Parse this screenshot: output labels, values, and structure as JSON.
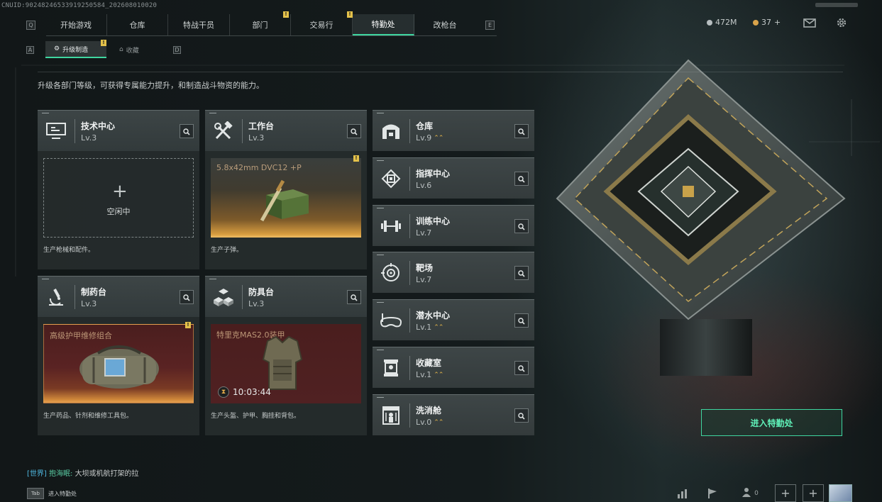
{
  "header": {
    "uid": "CNUID:9024824653391925058​4_202608010020",
    "resources": {
      "currency": "472M",
      "tickets": "37",
      "tickets_add": "+"
    },
    "keyhint_left": "Q",
    "keyhint_right": "E"
  },
  "nav": {
    "tabs": [
      {
        "label": "开始游戏",
        "badge": ""
      },
      {
        "label": "仓库",
        "badge": ""
      },
      {
        "label": "特战干员",
        "badge": ""
      },
      {
        "label": "部门",
        "badge": "!"
      },
      {
        "label": "交易行",
        "badge": ""
      },
      {
        "label": "特勤处",
        "badge": "!",
        "active": true
      },
      {
        "label": "改枪台",
        "badge": ""
      }
    ]
  },
  "subnav": {
    "keyhint_left": "A",
    "keyhint_right": "D",
    "tabs": [
      {
        "label": "升级制造",
        "active": true,
        "badge": "!"
      },
      {
        "label": "收藏",
        "active": false
      }
    ]
  },
  "description": "升级各部门等级，可获得专属能力提升，和制造战斗物资的能力。",
  "departments_large": [
    {
      "name": "技术中心",
      "level": "Lv.3",
      "icon": "monitor-icon",
      "slot_state": "idle",
      "idle_label": "空闲中",
      "footer": "生产枪械和配件。"
    },
    {
      "name": "工作台",
      "level": "Lv.3",
      "icon": "tools-icon",
      "slot_state": "ready",
      "slot_title": "5.8x42mm DVC12 +P",
      "footer": "生产子弹。",
      "badge": "!"
    },
    {
      "name": "制药台",
      "level": "Lv.3",
      "icon": "microscope-icon",
      "slot_state": "ready",
      "slot_title": "高级护甲维修组合",
      "footer": "生产药品、针剂和维修工具包。",
      "badge": "!"
    },
    {
      "name": "防具台",
      "level": "Lv.3",
      "icon": "cubes-icon",
      "slot_state": "crafting",
      "slot_title": "特里克MAS2.0装甲",
      "timer": "10:03:44",
      "footer": "生产头盔、护甲、胸挂和背包。"
    }
  ],
  "departments_small": [
    {
      "name": "仓库",
      "level": "Lv.9",
      "icon": "warehouse-icon",
      "upgradable": true
    },
    {
      "name": "指挥中心",
      "level": "Lv.6",
      "icon": "chip-icon",
      "upgradable": false
    },
    {
      "name": "训练中心",
      "level": "Lv.7",
      "icon": "dumbbell-icon",
      "upgradable": false
    },
    {
      "name": "靶场",
      "level": "Lv.7",
      "icon": "target-icon",
      "upgradable": false
    },
    {
      "name": "潜水中心",
      "level": "Lv.1",
      "icon": "diving-mask-icon",
      "upgradable": true
    },
    {
      "name": "收藏室",
      "level": "Lv.1",
      "icon": "display-case-icon",
      "upgradable": true
    },
    {
      "name": "洗消舱",
      "level": "Lv.0",
      "icon": "decon-chamber-icon",
      "upgradable": true
    }
  ],
  "enter_button": "进入特勤处",
  "chat": {
    "channel": "[世界]",
    "name": "抱海眠:",
    "message": "大坝或机航打架的拉"
  },
  "tab_hint": {
    "key": "Tab",
    "label": "进入特勤处"
  },
  "footer_icons": {
    "friends_count": "0"
  },
  "colors": {
    "accent": "#3fd6a0",
    "badge": "#e3c14a",
    "upgrade_arrow": "#e3b44a",
    "ammo_glow": "#d89d3f",
    "red_slot": "#5a2323"
  }
}
